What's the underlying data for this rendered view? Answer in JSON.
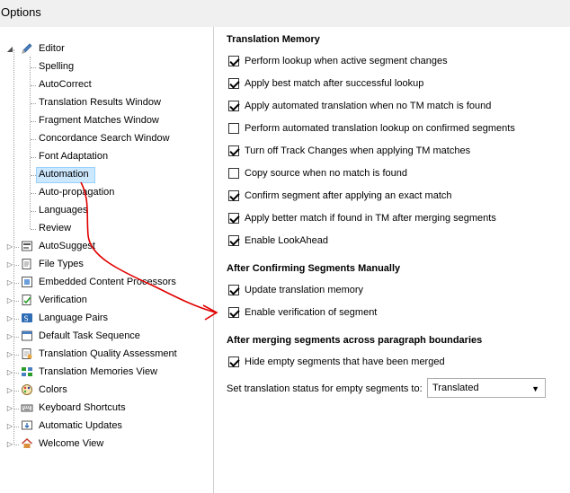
{
  "window": {
    "title": "Options"
  },
  "tree": {
    "items": [
      {
        "label": "Editor",
        "level": 0,
        "expanded": true,
        "icon": "pencil-icon"
      },
      {
        "label": "Spelling",
        "level": 1
      },
      {
        "label": "AutoCorrect",
        "level": 1
      },
      {
        "label": "Translation Results Window",
        "level": 1
      },
      {
        "label": "Fragment Matches Window",
        "level": 1
      },
      {
        "label": "Concordance Search Window",
        "level": 1
      },
      {
        "label": "Font Adaptation",
        "level": 1
      },
      {
        "label": "Automation",
        "level": 1,
        "selected": true
      },
      {
        "label": "Auto-propagation",
        "level": 1
      },
      {
        "label": "Languages",
        "level": 1
      },
      {
        "label": "Review",
        "level": 1
      },
      {
        "label": "AutoSuggest",
        "level": 0,
        "icon": "autosuggest-icon"
      },
      {
        "label": "File Types",
        "level": 0,
        "icon": "file-types-icon"
      },
      {
        "label": "Embedded Content Processors",
        "level": 0,
        "icon": "embedded-content-icon"
      },
      {
        "label": "Verification",
        "level": 0,
        "icon": "verification-icon"
      },
      {
        "label": "Language Pairs",
        "level": 0,
        "icon": "language-pairs-icon"
      },
      {
        "label": "Default Task Sequence",
        "level": 0,
        "icon": "task-sequence-icon"
      },
      {
        "label": "Translation Quality Assessment",
        "level": 0,
        "icon": "quality-assessment-icon"
      },
      {
        "label": "Translation Memories View",
        "level": 0,
        "icon": "tm-view-icon"
      },
      {
        "label": "Colors",
        "level": 0,
        "icon": "colors-icon"
      },
      {
        "label": "Keyboard Shortcuts",
        "level": 0,
        "icon": "keyboard-icon"
      },
      {
        "label": "Automatic Updates",
        "level": 0,
        "icon": "updates-icon"
      },
      {
        "label": "Welcome View",
        "level": 0,
        "icon": "home-icon"
      }
    ]
  },
  "sections": {
    "tm": {
      "title": "Translation Memory",
      "options": [
        {
          "label": "Perform lookup when active segment changes",
          "checked": true
        },
        {
          "label": "Apply best match after successful lookup",
          "checked": true
        },
        {
          "label": "Apply automated translation when no TM match is found",
          "checked": true
        },
        {
          "label": "Perform automated translation lookup on confirmed segments",
          "checked": false
        },
        {
          "label": "Turn off Track Changes when applying TM matches",
          "checked": true
        },
        {
          "label": "Copy source when no match is found",
          "checked": false
        },
        {
          "label": "Confirm segment after applying an exact match",
          "checked": true
        },
        {
          "label": "Apply better match if found in TM after merging segments",
          "checked": true
        },
        {
          "label": "Enable LookAhead",
          "checked": true
        }
      ]
    },
    "confirm": {
      "title": "After Confirming Segments Manually",
      "options": [
        {
          "label": "Update translation memory",
          "checked": true
        },
        {
          "label": "Enable verification of segment",
          "checked": true
        }
      ]
    },
    "merge": {
      "title": "After merging segments across paragraph boundaries",
      "options": [
        {
          "label": "Hide empty segments that have been merged",
          "checked": true
        }
      ]
    }
  },
  "status": {
    "label": "Set translation status for empty segments to:",
    "value": "Translated"
  },
  "colors": {
    "selection": "#cce8ff",
    "annotation": "#e00000"
  }
}
